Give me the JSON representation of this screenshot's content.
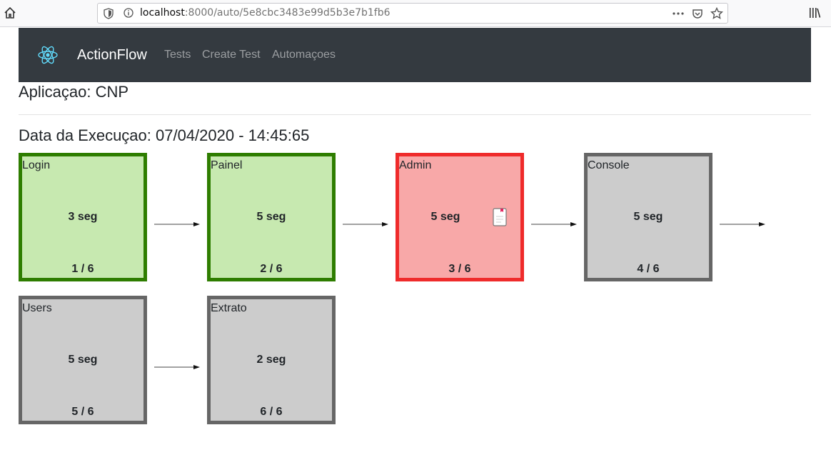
{
  "browser": {
    "url_host": "localhost",
    "url_rest": ":8000/auto/5e8cbc3483e99d5b3e7b1fb6"
  },
  "navbar": {
    "brand": "ActionFlow",
    "links": [
      "Tests",
      "Create Test",
      "Automaçoes"
    ]
  },
  "page": {
    "application_title": "Aplicaçao: CNP",
    "execution_title": "Data da Execuçao: 07/04/2020 - 14:45:65"
  },
  "colors": {
    "success_bg": "#c7e9b0",
    "success_border": "#2e7d00",
    "fail_bg": "#f8a8a8",
    "fail_border": "#ef2b2b",
    "pending_bg": "#cccccc",
    "pending_border": "#666666",
    "navbar_bg": "#343a40"
  },
  "steps": [
    {
      "name": "Login",
      "time": "3 seg",
      "index": "1 / 6",
      "status": "success"
    },
    {
      "name": "Painel",
      "time": "5 seg",
      "index": "2 / 6",
      "status": "success"
    },
    {
      "name": "Admin",
      "time": "5 seg",
      "index": "3 / 6",
      "status": "fail",
      "icon": "document-icon"
    },
    {
      "name": "Console",
      "time": "5 seg",
      "index": "4 / 6",
      "status": "pending"
    },
    {
      "name": "Users",
      "time": "5 seg",
      "index": "5 / 6",
      "status": "pending"
    },
    {
      "name": "Extrato",
      "time": "2 seg",
      "index": "6 / 6",
      "status": "pending"
    }
  ]
}
